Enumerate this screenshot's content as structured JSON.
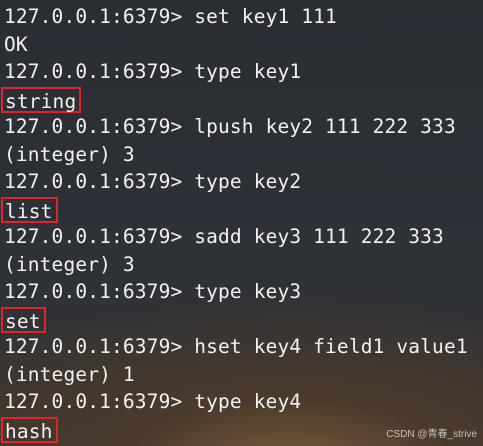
{
  "terminal": {
    "lines": [
      {
        "kind": "input",
        "prompt": "127.0.0.1:6379>",
        "command": " set key1 111"
      },
      {
        "kind": "output",
        "text": "OK",
        "highlight": false
      },
      {
        "kind": "input",
        "prompt": "127.0.0.1:6379>",
        "command": " type key1"
      },
      {
        "kind": "output",
        "text": "string",
        "highlight": true
      },
      {
        "kind": "input",
        "prompt": "127.0.0.1:6379>",
        "command": " lpush key2 111 222 333"
      },
      {
        "kind": "output",
        "text": "(integer) 3",
        "highlight": false
      },
      {
        "kind": "input",
        "prompt": "127.0.0.1:6379>",
        "command": " type key2"
      },
      {
        "kind": "output",
        "text": "list",
        "highlight": true
      },
      {
        "kind": "input",
        "prompt": "127.0.0.1:6379>",
        "command": " sadd key3 111 222 333"
      },
      {
        "kind": "output",
        "text": "(integer) 3",
        "highlight": false
      },
      {
        "kind": "input",
        "prompt": "127.0.0.1:6379>",
        "command": " type key3"
      },
      {
        "kind": "output",
        "text": "set",
        "highlight": true
      },
      {
        "kind": "input",
        "prompt": "127.0.0.1:6379>",
        "command": " hset key4 field1 value1"
      },
      {
        "kind": "output",
        "text": "(integer) 1",
        "highlight": false
      },
      {
        "kind": "input",
        "prompt": "127.0.0.1:6379>",
        "command": " type key4"
      },
      {
        "kind": "output",
        "text": "hash",
        "highlight": true
      }
    ]
  },
  "watermark": "CSDN @青春_strive",
  "colors": {
    "text": "#f2f2f2",
    "highlight_border": "#e0242a",
    "background": "#2c3036"
  }
}
